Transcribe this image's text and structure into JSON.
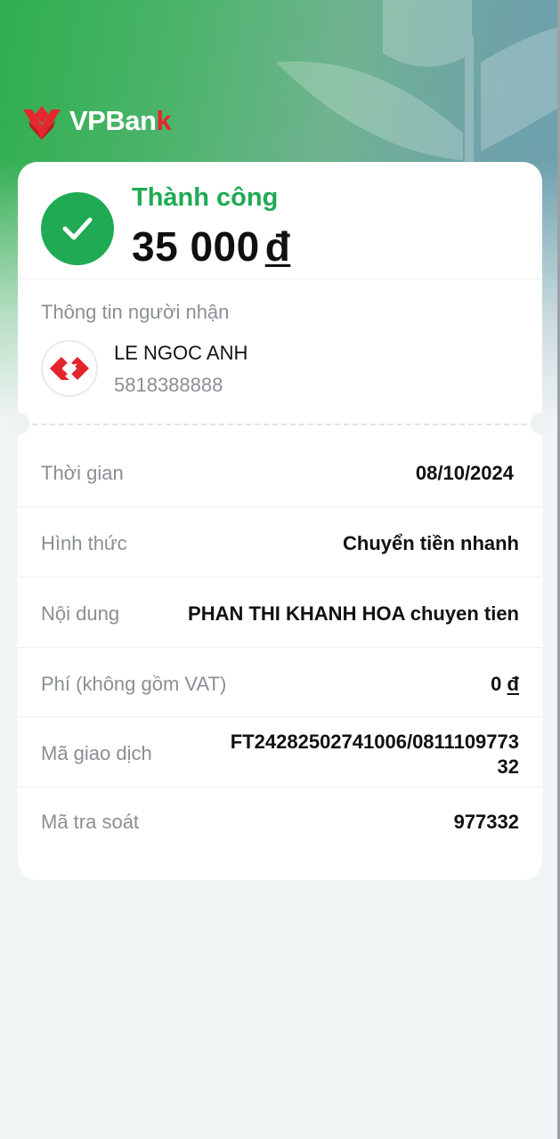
{
  "brand": {
    "name_part1": "VPBan",
    "name_part2": "k",
    "accent_color": "#e6272d"
  },
  "status": {
    "label": "Thành công",
    "color": "#1faa53",
    "icon": "check-icon"
  },
  "amount": {
    "value": "35 000",
    "currency": "đ"
  },
  "recipient": {
    "section_title": "Thông tin người nhận",
    "name": "LE NGOC ANH",
    "account": "5818388888",
    "bank_icon": "bank-logo-icon"
  },
  "details": [
    {
      "label": "Thời gian",
      "value": "08/10/2024"
    },
    {
      "label": "Hình thức",
      "value": "Chuyển tiền nhanh"
    },
    {
      "label": "Nội dung",
      "value": "PHAN THI KHANH HOA chuyen tien"
    },
    {
      "label": "Phí (không gồm VAT)",
      "value": "0",
      "currency": "đ"
    },
    {
      "label": "Mã giao dịch",
      "value_line1": "FT24282502741006/0811109773",
      "value_line2": "32"
    },
    {
      "label": "Mã tra soát",
      "value": "977332"
    }
  ]
}
